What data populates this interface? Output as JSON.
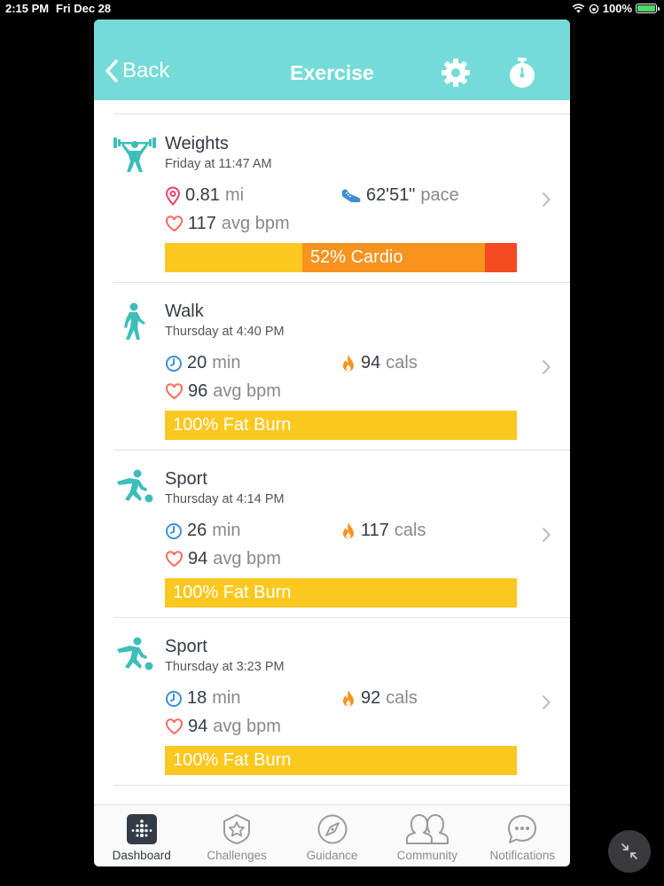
{
  "status": {
    "time": "2:15 PM",
    "date": "Fri Dec 28",
    "battery": "100%"
  },
  "header": {
    "back_label": "Back",
    "title": "Exercise",
    "accent": "#74dbd8"
  },
  "exercises": [
    {
      "name": "Weights",
      "time": "Friday at 11:47 AM",
      "icon": "weights-icon",
      "stat1": {
        "icon": "location-pin-icon",
        "value": "0.81",
        "unit": "mi"
      },
      "stat2": {
        "icon": "shoe-icon",
        "value": "62'51\"",
        "unit": "pace"
      },
      "stat3": {
        "icon": "heart-icon",
        "value": "117",
        "unit": "avg bpm"
      },
      "zone_label": "52% Cardio",
      "zone_segments": [
        {
          "zone": "fat-burn",
          "fraction": 0.39,
          "color": "#fbc820"
        },
        {
          "zone": "cardio",
          "fraction": 0.52,
          "color": "#f7931e"
        },
        {
          "zone": "peak",
          "fraction": 0.09,
          "color": "#f44a1f"
        }
      ]
    },
    {
      "name": "Walk",
      "time": "Thursday at 4:40 PM",
      "icon": "walk-icon",
      "stat1": {
        "icon": "clock-icon",
        "value": "20",
        "unit": "min"
      },
      "stat2": {
        "icon": "flame-icon",
        "value": "94",
        "unit": "cals"
      },
      "stat3": {
        "icon": "heart-icon",
        "value": "96",
        "unit": "avg bpm"
      },
      "zone_label": "100% Fat Burn",
      "zone_segments": [
        {
          "zone": "fat-burn",
          "fraction": 1.0,
          "color": "#fbc820"
        }
      ]
    },
    {
      "name": "Sport",
      "time": "Thursday at 4:14 PM",
      "icon": "sport-icon",
      "stat1": {
        "icon": "clock-icon",
        "value": "26",
        "unit": "min"
      },
      "stat2": {
        "icon": "flame-icon",
        "value": "117",
        "unit": "cals"
      },
      "stat3": {
        "icon": "heart-icon",
        "value": "94",
        "unit": "avg bpm"
      },
      "zone_label": "100% Fat Burn",
      "zone_segments": [
        {
          "zone": "fat-burn",
          "fraction": 1.0,
          "color": "#fbc820"
        }
      ]
    },
    {
      "name": "Sport",
      "time": "Thursday at 3:23 PM",
      "icon": "sport-icon",
      "stat1": {
        "icon": "clock-icon",
        "value": "18",
        "unit": "min"
      },
      "stat2": {
        "icon": "flame-icon",
        "value": "92",
        "unit": "cals"
      },
      "stat3": {
        "icon": "heart-icon",
        "value": "94",
        "unit": "avg bpm"
      },
      "zone_label": "100% Fat Burn",
      "zone_segments": [
        {
          "zone": "fat-burn",
          "fraction": 1.0,
          "color": "#fbc820"
        }
      ]
    }
  ],
  "tabs": [
    {
      "label": "Dashboard",
      "icon": "dashboard-icon",
      "active": true
    },
    {
      "label": "Challenges",
      "icon": "challenges-icon",
      "active": false
    },
    {
      "label": "Guidance",
      "icon": "guidance-icon",
      "active": false
    },
    {
      "label": "Community",
      "icon": "community-icon",
      "active": false
    },
    {
      "label": "Notifications",
      "icon": "notifications-icon",
      "active": false
    }
  ]
}
